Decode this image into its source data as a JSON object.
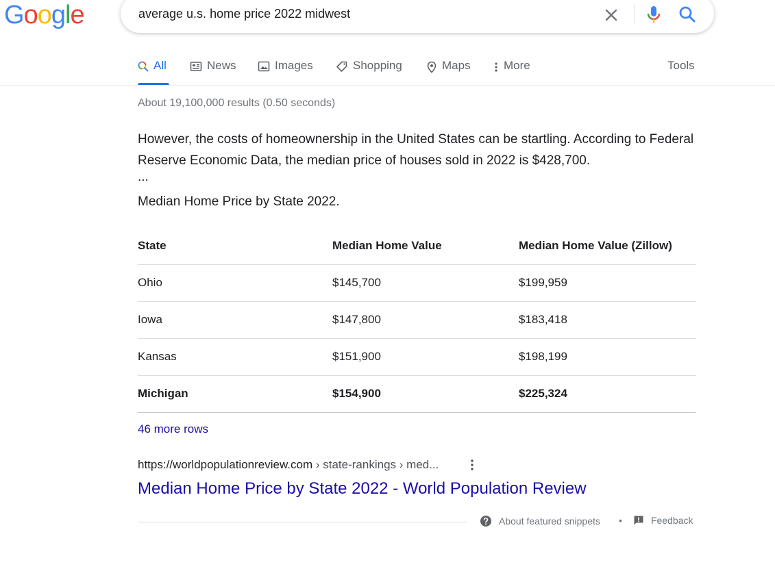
{
  "logo": {
    "letters": [
      "G",
      "o",
      "o",
      "g",
      "l",
      "e"
    ],
    "colors": [
      "#4285f4",
      "#ea4335",
      "#fbbc05",
      "#4285f4",
      "#34a853",
      "#ea4335"
    ]
  },
  "search": {
    "query": "average u.s. home price 2022 midwest"
  },
  "tabs": [
    {
      "label": "All",
      "icon": "search-multicolor-icon",
      "active": true
    },
    {
      "label": "News",
      "icon": "newspaper-icon"
    },
    {
      "label": "Images",
      "icon": "image-icon"
    },
    {
      "label": "Shopping",
      "icon": "tag-icon"
    },
    {
      "label": "Maps",
      "icon": "map-pin-icon"
    },
    {
      "label": "More",
      "icon": "vertical-dots-icon"
    }
  ],
  "tools_label": "Tools",
  "stats": "About 19,100,000 results (0.50 seconds)",
  "snippet": {
    "text": "However, the costs of homeownership in the United States can be startling. According to Federal Reserve Economic Data, the median price of houses sold in 2022 is $428,700.",
    "ellipsis": "...",
    "title": "Median Home Price by State 2022."
  },
  "table": {
    "headers": [
      "State",
      "Median Home Value",
      "Median Home Value (Zillow)"
    ],
    "rows": [
      [
        "Ohio",
        "$145,700",
        "$199,959"
      ],
      [
        "Iowa",
        "$147,800",
        "$183,418"
      ],
      [
        "Kansas",
        "$151,900",
        "$198,199"
      ],
      [
        "Michigan",
        "$154,900",
        "$225,324"
      ]
    ]
  },
  "more_rows": "46 more rows",
  "result": {
    "domain": "https://worldpopulationreview.com",
    "path": " › state-rankings › med...",
    "title": "Median Home Price by State 2022 - World Population Review"
  },
  "footer": {
    "about": "About featured snippets",
    "separator": "•",
    "feedback": "Feedback"
  },
  "colors": {
    "link": "#1a0dab",
    "accent": "#1a73e8",
    "muted": "#70757a"
  }
}
